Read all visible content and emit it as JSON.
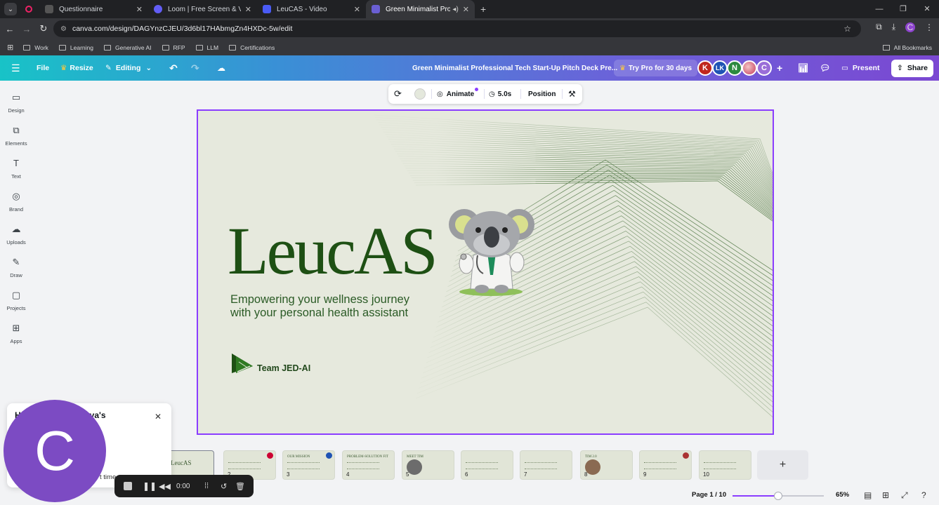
{
  "browser": {
    "tabs": [
      {
        "title": "Questionnaire",
        "color": "#6b6b6b"
      },
      {
        "title": "Loom | Free Screen & Video Re",
        "color": "#625df5"
      },
      {
        "title": "LeuCAS - Video",
        "color": "#4a5bf5"
      },
      {
        "title": "Green Minimalist Profession",
        "color": "#6a5fd3"
      }
    ],
    "url": "canva.com/design/DAGYnzCJEU/3d6bl17HAbmgZn4HXDc-5w/edit",
    "profile_initial": "C",
    "bookmarks": [
      "Work",
      "Learning",
      "Generative AI",
      "RFP",
      "LLM",
      "Certifications"
    ],
    "all_bookmarks": "All Bookmarks"
  },
  "header": {
    "file": "File",
    "resize": "Resize",
    "editing": "Editing",
    "title": "Green Minimalist Professional Tech Start-Up Pitch Deck Pre...",
    "try_pro": "Try Pro for 30 days",
    "avatars": [
      {
        "label": "K",
        "color": "#c0271e"
      },
      {
        "label": "LK",
        "color": "#1f53b4"
      },
      {
        "label": "N",
        "color": "#2d8a3e"
      },
      {
        "label": "",
        "color": "#d95a7a"
      },
      {
        "label": "C",
        "color": "#9a6ed8"
      }
    ],
    "present": "Present",
    "share": "Share"
  },
  "sidebar": {
    "items": [
      {
        "label": "Design",
        "icon": "▭"
      },
      {
        "label": "Elements",
        "icon": "⧉"
      },
      {
        "label": "Text",
        "icon": "T"
      },
      {
        "label": "Brand",
        "icon": "◎"
      },
      {
        "label": "Uploads",
        "icon": "☁"
      },
      {
        "label": "Draw",
        "icon": "✎"
      },
      {
        "label": "Projects",
        "icon": "▢"
      },
      {
        "label": "Apps",
        "icon": "⊞"
      }
    ]
  },
  "toolbar": {
    "animate": "Animate",
    "duration": "5.0s",
    "position": "Position"
  },
  "slide": {
    "title": "LeucAS",
    "tagline": "Empowering your wellness journey with your personal health assistant",
    "team": "Team JED-AI",
    "accent_color": "#1e5014"
  },
  "survey": {
    "question_prefix": "H",
    "question_suffix": "anva's",
    "question_line2": "e?",
    "option": "t time"
  },
  "camera": {
    "initial": "C"
  },
  "recorder": {
    "time": "0:00"
  },
  "thumbnails": [
    {
      "num": "",
      "label": "LeucAS"
    },
    {
      "num": "2",
      "label": "Together"
    },
    {
      "num": "3",
      "label": "OUR MISSION"
    },
    {
      "num": "4",
      "label": "PROBLEM-SOLUTION FIT"
    },
    {
      "num": "5",
      "label": "MEET TIM"
    },
    {
      "num": "6",
      "label": "Let's see"
    },
    {
      "num": "7",
      "label": "VISION & STRATEGY"
    },
    {
      "num": "8",
      "label": "TIM 2.0"
    },
    {
      "num": "9",
      "label": "TEAM"
    },
    {
      "num": "10",
      "label": "Join us"
    }
  ],
  "footer": {
    "page_indicator": "Page 1 / 10",
    "zoom": "65%",
    "zoom_fraction": 0.5
  }
}
